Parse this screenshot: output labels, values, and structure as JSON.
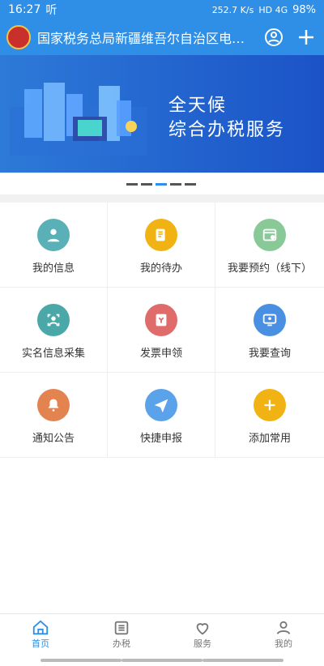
{
  "status": {
    "time": "16:27",
    "extra": "听",
    "speed": "252.7 K/s",
    "network": "HD 4G",
    "battery": "98%"
  },
  "appbar": {
    "title": "国家税务总局新疆维吾尔自治区电子税…"
  },
  "banner": {
    "line1": "全天候",
    "line2": "综合办税服务"
  },
  "grid": {
    "items": [
      {
        "label": "我的信息",
        "color": "#5ab0b7"
      },
      {
        "label": "我的待办",
        "color": "#f0b313"
      },
      {
        "label": "我要预约（线下）",
        "color": "#89c998"
      },
      {
        "label": "实名信息采集",
        "color": "#4aa8a9"
      },
      {
        "label": "发票申领",
        "color": "#e06b6b"
      },
      {
        "label": "我要查询",
        "color": "#4a90e2"
      },
      {
        "label": "通知公告",
        "color": "#e3834f"
      },
      {
        "label": "快捷申报",
        "color": "#5aa3ea"
      },
      {
        "label": "添加常用",
        "color": "#f0b313"
      }
    ]
  },
  "bottomnav": {
    "items": [
      {
        "label": "首页",
        "icon": "home-icon"
      },
      {
        "label": "办税",
        "icon": "list-icon"
      },
      {
        "label": "服务",
        "icon": "heart-icon"
      },
      {
        "label": "我的",
        "icon": "user-icon"
      }
    ]
  }
}
